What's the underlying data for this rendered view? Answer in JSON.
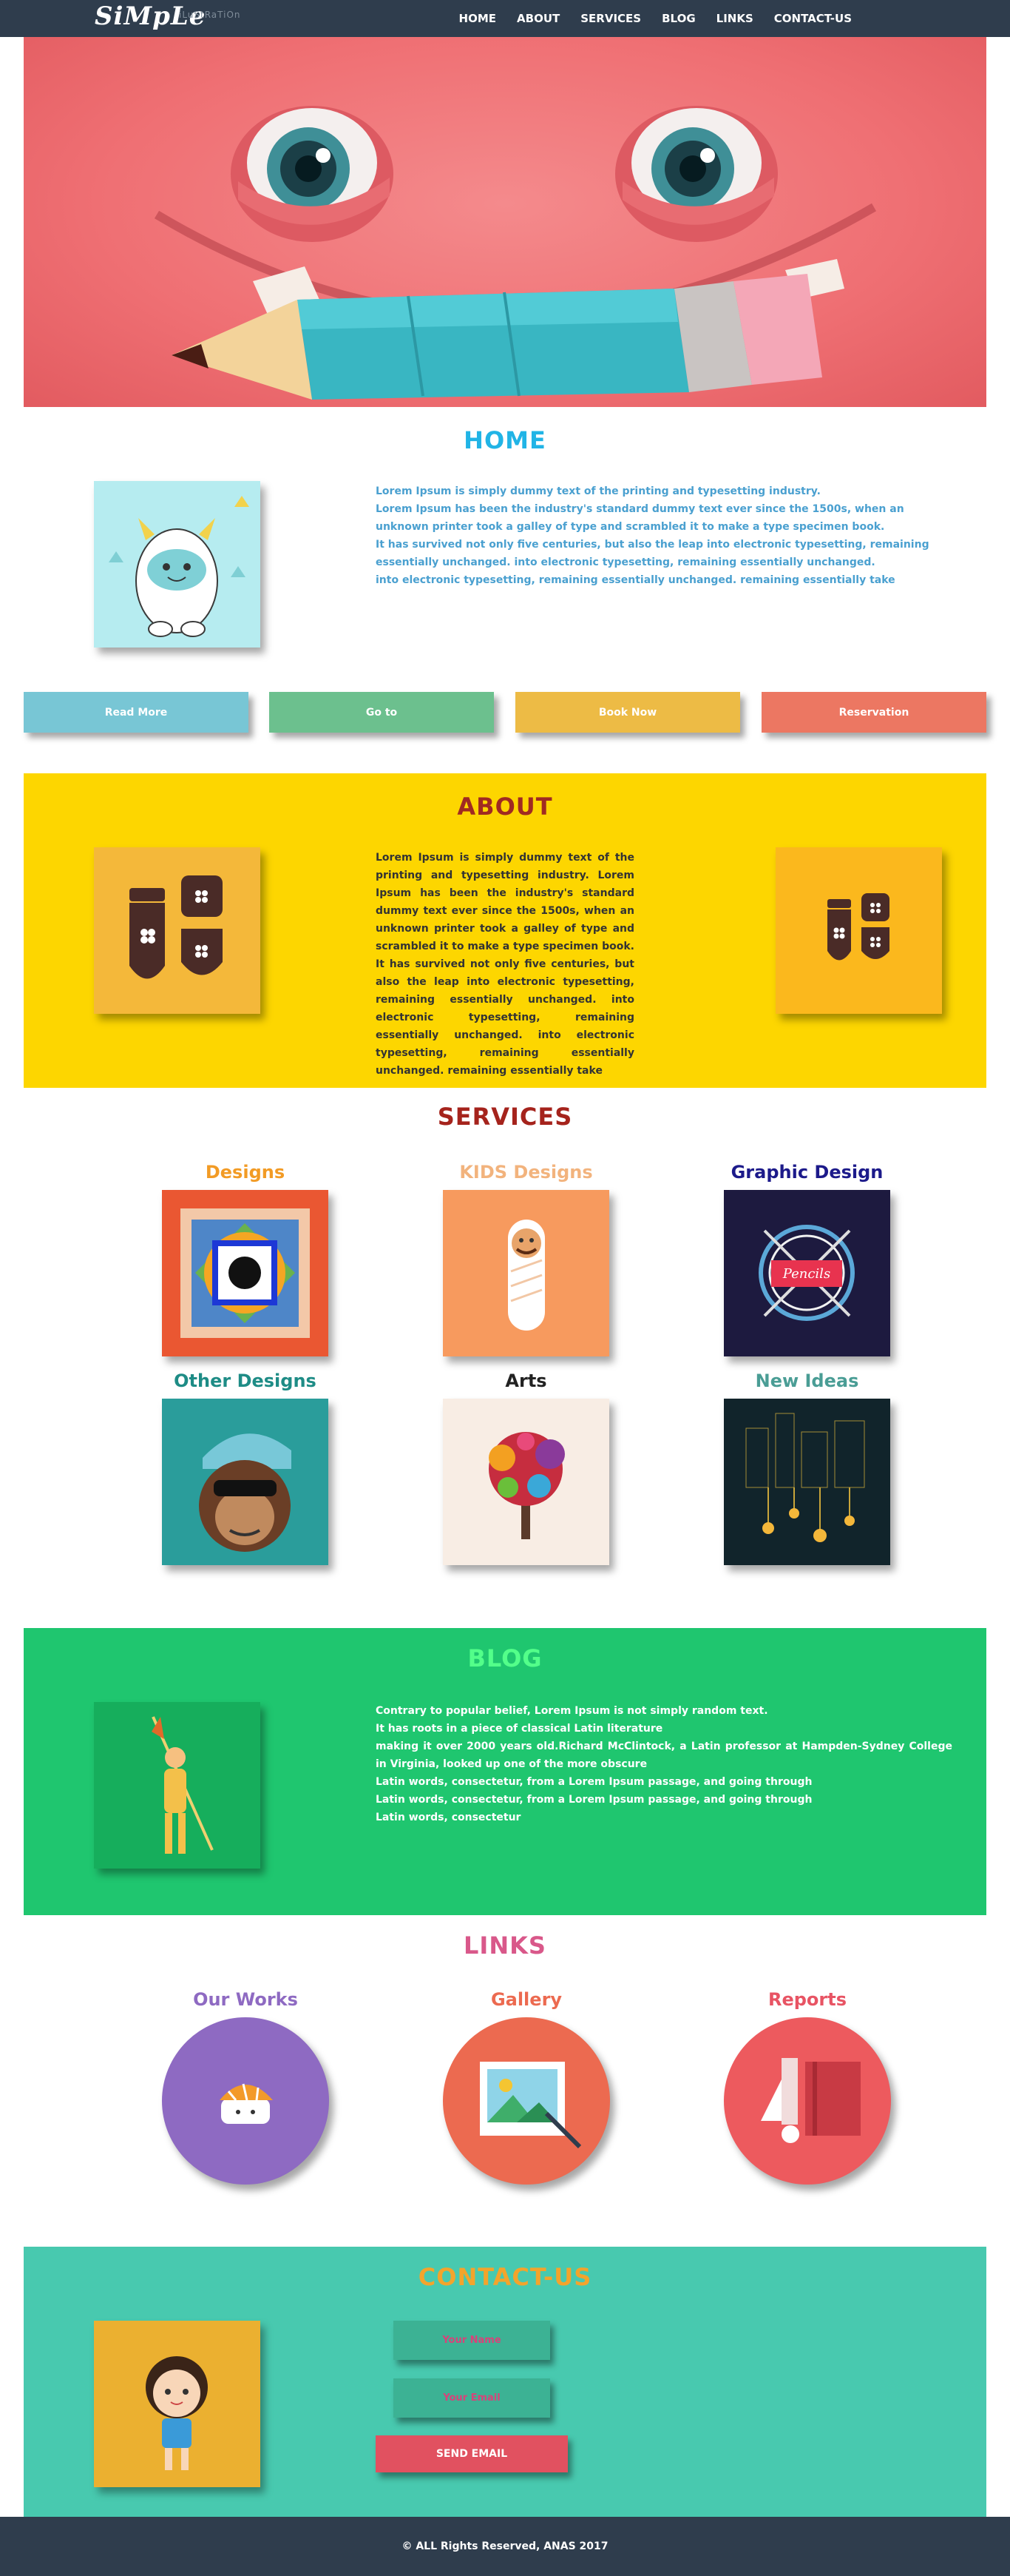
{
  "header": {
    "logo": "SiMpLe",
    "logo_sub": "iLuStRaTiOn",
    "nav": [
      "HOME",
      "ABOUT",
      "SERVICES",
      "BLOG",
      "LINKS",
      "CONTACT-US"
    ]
  },
  "home": {
    "title": "HOME",
    "paragraphs": [
      "Lorem Ipsum is simply dummy text of the printing and typesetting industry.",
      "Lorem Ipsum has been the industry's standard dummy text ever since the 1500s, when an unknown printer took a galley of type and scrambled it to make a type specimen book.",
      "It has survived not only five centuries, but also the leap into electronic typesetting, remaining essentially unchanged. into electronic typesetting, remaining essentially unchanged.",
      "into electronic typesetting, remaining essentially unchanged. remaining essentially take"
    ]
  },
  "buttons": [
    {
      "label": "Read More",
      "color": "#78c6d5"
    },
    {
      "label": "Go to",
      "color": "#6cc08e"
    },
    {
      "label": "Book Now",
      "color": "#edbb45"
    },
    {
      "label": "Reservation",
      "color": "#ec7762"
    }
  ],
  "about": {
    "title": "ABOUT",
    "text": "Lorem Ipsum is simply dummy text of the printing and typesetting industry. Lorem Ipsum has been the industry's standard dummy text ever since the 1500s, when an unknown printer took a galley of type and scrambled it to make a type specimen book. It has survived not only five centuries, but also the leap into electronic typesetting, remaining essentially unchanged. into electronic typesetting, remaining essentially unchanged. into electronic typesetting, remaining essentially unchanged. remaining essentially take"
  },
  "services": {
    "title": "SERVICES",
    "items": [
      {
        "label": "Designs",
        "color": "#f29b25"
      },
      {
        "label": "KIDS Designs",
        "color": "#f2b37d"
      },
      {
        "label": "Graphic Design",
        "color": "#1c1a8a"
      },
      {
        "label": "Other Designs",
        "color": "#1e8c86"
      },
      {
        "label": "Arts",
        "color": "#222222"
      },
      {
        "label": "New Ideas",
        "color": "#4a9d95"
      }
    ]
  },
  "blog": {
    "title": "BLOG",
    "paragraphs": [
      "Contrary to popular belief, Lorem Ipsum is not simply random text.",
      "It has roots in a piece of classical Latin literature",
      "making it over 2000 years old.Richard McClintock, a Latin professor at Hampden-Sydney College in Virginia, looked up one of the more obscure",
      "Latin words, consectetur, from a Lorem Ipsum passage, and going through",
      "Latin words, consectetur, from a Lorem Ipsum passage, and going through",
      "Latin words, consectetur"
    ]
  },
  "links": {
    "title": "LINKS",
    "items": [
      {
        "label": "Our Works",
        "color": "#8e6ac2"
      },
      {
        "label": "Gallery",
        "color": "#ec6a50"
      },
      {
        "label": "Reports",
        "color": "#e85464"
      }
    ]
  },
  "contact": {
    "title": "CONTACT-US",
    "name_placeholder": "Your Name",
    "email_placeholder": "Your Email",
    "send_label": "SEND EMAIL"
  },
  "footer": {
    "text": "© ALL Rights Reserved, ANAS 2017"
  }
}
